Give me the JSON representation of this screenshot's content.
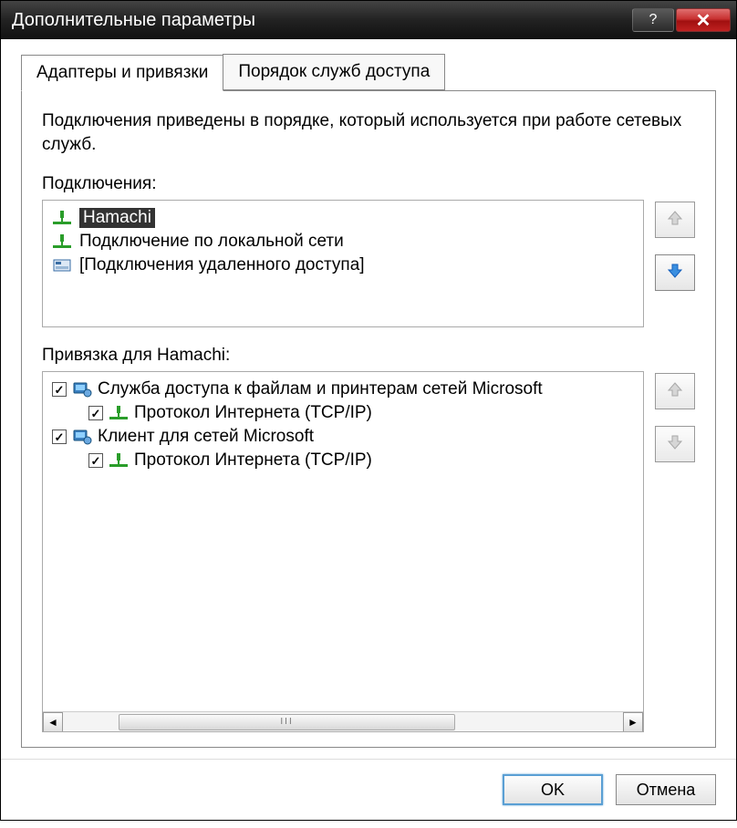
{
  "window": {
    "title": "Дополнительные параметры"
  },
  "tabs": {
    "adapters": "Адаптеры и привязки",
    "provider_order": "Порядок служб доступа"
  },
  "description": "Подключения приведены в порядке, который используется при работе сетевых служб.",
  "connections": {
    "label": "Подключения:",
    "items": [
      {
        "text": "Hamachi",
        "icon": "net-adapter",
        "selected": true
      },
      {
        "text": "Подключение по локальной сети",
        "icon": "net-adapter",
        "selected": false
      },
      {
        "text": "[Подключения удаленного доступа]",
        "icon": "dialup",
        "selected": false
      }
    ]
  },
  "bindings": {
    "label": "Привязка для Hamachi:",
    "items": [
      {
        "text": "Служба доступа к файлам и принтерам сетей Microsoft",
        "checked": true,
        "icon": "service",
        "children": [
          {
            "text": "Протокол Интернета (TCP/IP)",
            "checked": true,
            "icon": "net-adapter"
          }
        ]
      },
      {
        "text": "Клиент для сетей Microsoft",
        "checked": true,
        "icon": "service",
        "children": [
          {
            "text": "Протокол Интернета (TCP/IP)",
            "checked": true,
            "icon": "net-adapter"
          }
        ]
      }
    ]
  },
  "buttons": {
    "ok": "OK",
    "cancel": "Отмена"
  }
}
